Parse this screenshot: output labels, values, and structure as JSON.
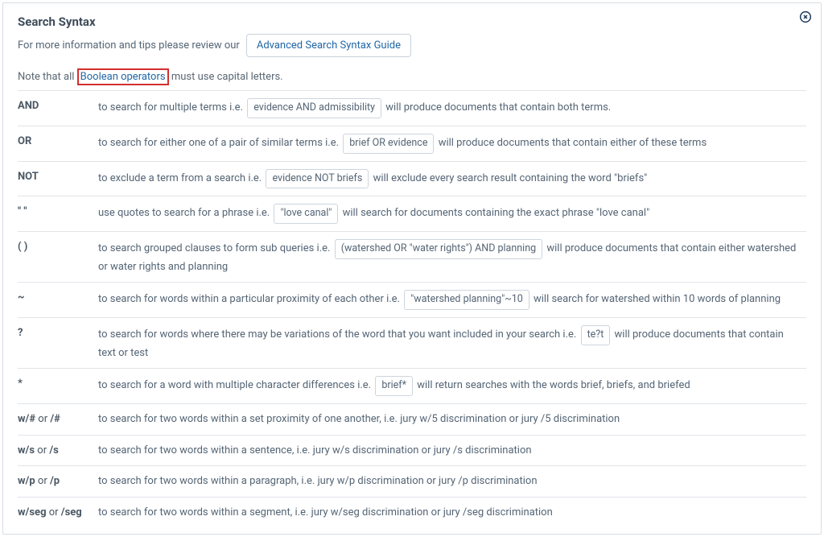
{
  "header": {
    "title": "Search Syntax",
    "subtitle_prefix": "For more information and tips please review our",
    "guide_link": "Advanced Search Syntax Guide",
    "note_pre": "Note that all ",
    "note_highlight": "Boolean operators",
    "note_post": " must use capital letters."
  },
  "rows": {
    "and": {
      "op": "AND",
      "pre": "to search for multiple terms i.e.",
      "pill": "evidence AND admissibility",
      "post": "will produce documents that contain both terms."
    },
    "or": {
      "op": "OR",
      "pre": "to search for either one of a pair of similar terms i.e.",
      "pill": "brief OR evidence",
      "post": "will produce documents that contain either of these terms"
    },
    "not": {
      "op": "NOT",
      "pre": "to exclude a term from a search i.e.",
      "pill": "evidence NOT briefs",
      "post": "will exclude every search result containing the word \"briefs\""
    },
    "quotes": {
      "op": "\" \"",
      "pre": "use quotes to search for a phrase i.e.",
      "pill": "\"love canal\"",
      "post": "will search for documents containing the exact phrase \"love canal\""
    },
    "parens": {
      "op": "( )",
      "pre": "to search grouped clauses to form sub queries i.e.",
      "pill": "(watershed OR \"water rights\") AND planning",
      "post": "will produce documents that contain either watershed or water rights and planning"
    },
    "tilde": {
      "op": "~",
      "pre": "to search for words within a particular proximity of each other i.e.",
      "pill": "\"watershed planning\"~10",
      "post": "will search for watershed within 10 words of planning"
    },
    "question": {
      "op": "?",
      "pre": "to search for words where there may be variations of the word that you want included in your search i.e.",
      "pill": "te?t",
      "post": "will produce documents that contain text or test"
    },
    "star": {
      "op": "*",
      "pre": "to search for a word with multiple character differences i.e.",
      "pill": "brief*",
      "post": "will return searches with the words brief, briefs, and briefed"
    },
    "wnum": {
      "op_a": "w/#",
      "op_or": " or ",
      "op_b": "/#",
      "desc": "to search for two words within a set proximity of one another, i.e. jury w/5 discrimination or jury /5 discrimination"
    },
    "ws": {
      "op_a": "w/s",
      "op_or": " or ",
      "op_b": "/s",
      "desc": "to search for two words within a sentence, i.e. jury w/s discrimination or jury /s discrimination"
    },
    "wp": {
      "op_a": "w/p",
      "op_or": " or ",
      "op_b": "/p",
      "desc": "to search for two words within a paragraph, i.e. jury w/p discrimination or jury /p discrimination"
    },
    "wseg": {
      "op_a": "w/seg",
      "op_or": " or ",
      "op_b": "/seg",
      "desc": "to search for two words within a segment, i.e. jury w/seg discrimination or jury /seg discrimination"
    }
  }
}
